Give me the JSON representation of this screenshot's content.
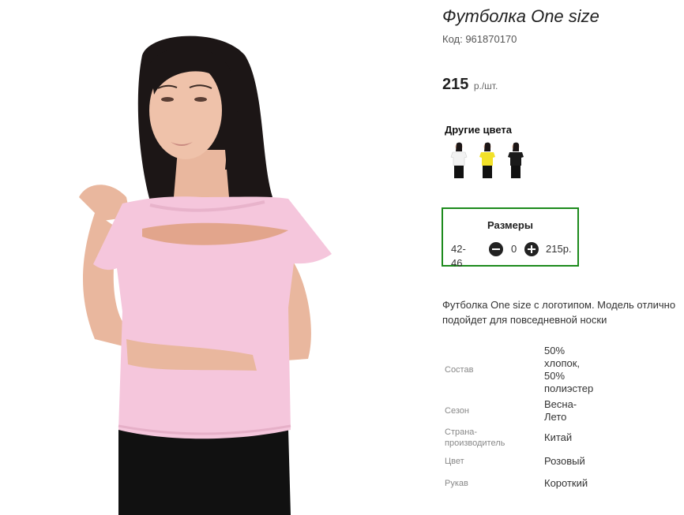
{
  "product": {
    "title": "Футболка One size",
    "code": "Код: 961870170",
    "price": "215",
    "price_unit": "р./шт."
  },
  "other_colors": {
    "title": "Другие цвета",
    "items": [
      {
        "color": "#ffffff"
      },
      {
        "color": "#f2e12a"
      },
      {
        "color": "#1a1a1a"
      }
    ]
  },
  "sizes": {
    "title": "Размеры",
    "rows": [
      {
        "size": "42-46",
        "qty": "0",
        "price": "215р."
      }
    ]
  },
  "description": "Футболка One size с логотипом. Модель отлично подойдет для повседневной носки",
  "properties": [
    {
      "label": "Состав",
      "value": "50% хлопок, 50% полиэстер"
    },
    {
      "label": "Сезон",
      "value": "Весна-Лето"
    },
    {
      "label": "Страна-производитель",
      "value": "Китай"
    },
    {
      "label": "Цвет",
      "value": "Розовый"
    },
    {
      "label": "Рукав",
      "value": "Короткий"
    }
  ],
  "icons": {
    "minus": "minus-circle-icon",
    "plus": "plus-circle-icon"
  },
  "colors": {
    "accent_border": "#1c8a1c",
    "tshirt": "#f5c6dc"
  }
}
